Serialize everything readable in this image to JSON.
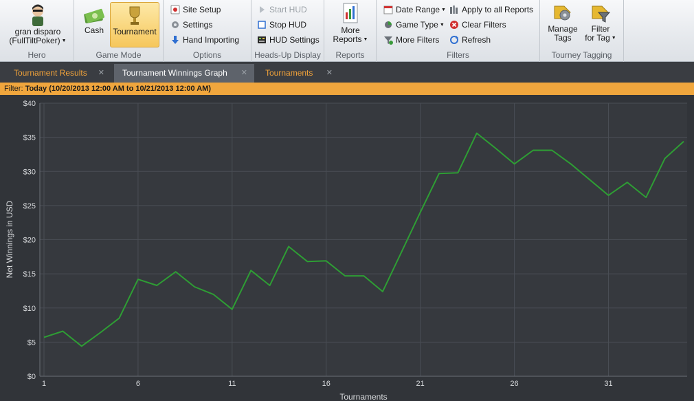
{
  "ribbon": {
    "hero": {
      "name_line1": "gran disparo",
      "name_line2": "(FullTiltPoker)",
      "label": "Hero",
      "icon": "user-avatar-icon"
    },
    "game_mode": {
      "cash": "Cash",
      "tournament": "Tournament",
      "label": "Game Mode"
    },
    "options": {
      "site_setup": "Site Setup",
      "settings": "Settings",
      "hand_importing": "Hand Importing",
      "label": "Options"
    },
    "hud": {
      "start": "Start HUD",
      "stop": "Stop HUD",
      "settings": "HUD Settings",
      "label": "Heads-Up Display"
    },
    "reports": {
      "more_line1": "More",
      "more_line2": "Reports",
      "label": "Reports"
    },
    "filters": {
      "date_range": "Date Range",
      "game_type": "Game Type",
      "more_filters": "More Filters",
      "apply_all": "Apply to all Reports",
      "clear": "Clear Filters",
      "refresh": "Refresh",
      "label": "Filters"
    },
    "tagging": {
      "manage_line1": "Manage",
      "manage_line2": "Tags",
      "filter_line1": "Filter",
      "filter_line2": "for Tag",
      "label": "Tourney Tagging"
    }
  },
  "tabs": [
    {
      "label": "Tournament Results",
      "active": false
    },
    {
      "label": "Tournament Winnings Graph",
      "active": true
    },
    {
      "label": "Tournaments",
      "active": false
    }
  ],
  "filter": {
    "prefix": "Filter:",
    "value": "Today (10/20/2013 12:00 AM to 10/21/2013 12:00 AM)"
  },
  "chart_data": {
    "type": "line",
    "xlabel": "Tournaments",
    "ylabel": "Net Winnings in USD",
    "xlim": [
      1,
      35
    ],
    "ylim": [
      0,
      40
    ],
    "x_ticks": [
      1,
      6,
      11,
      16,
      21,
      26,
      31
    ],
    "y_ticks": [
      "$0",
      "$5",
      "$10",
      "$15",
      "$20",
      "$25",
      "$30",
      "$35",
      "$40"
    ],
    "grid": true,
    "line_color": "#2e9e34",
    "x": [
      1,
      2,
      3,
      4,
      5,
      6,
      7,
      8,
      9,
      10,
      11,
      12,
      13,
      14,
      15,
      16,
      17,
      18,
      19,
      20,
      21,
      22,
      23,
      24,
      25,
      26,
      27,
      28,
      29,
      30,
      31,
      32,
      33,
      34,
      35
    ],
    "values": [
      5.7,
      6.6,
      4.4,
      6.4,
      8.5,
      14.2,
      13.3,
      15.3,
      13.1,
      12.0,
      9.8,
      15.5,
      13.3,
      19.0,
      16.8,
      16.9,
      14.7,
      14.7,
      12.4,
      18.2,
      24.0,
      29.7,
      29.8,
      35.6,
      33.4,
      31.1,
      33.1,
      33.1,
      31.1,
      28.8,
      26.5,
      28.4,
      26.2,
      31.9,
      34.4
    ]
  }
}
